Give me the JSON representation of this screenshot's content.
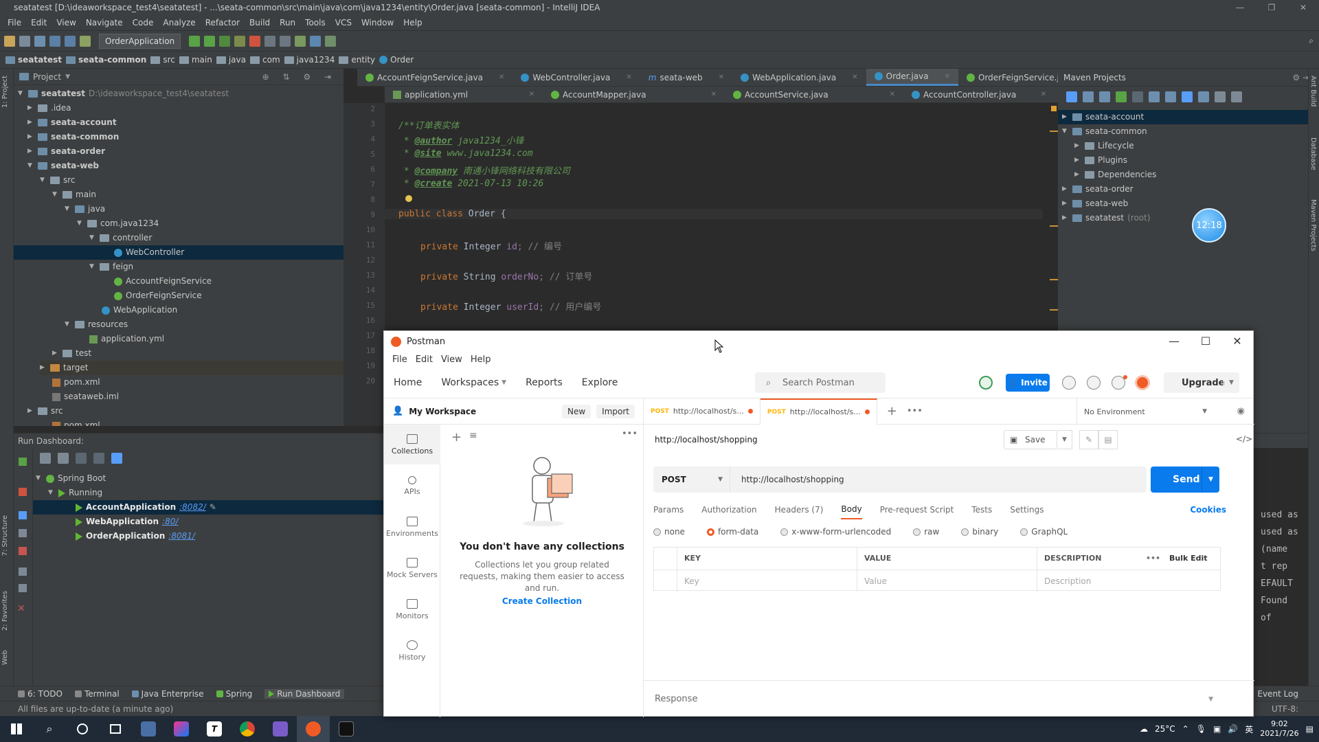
{
  "ide": {
    "title": "seatatest [D:\\ideaworkspace_test4\\seatatest] - ...\\seata-common\\src\\main\\java\\com\\java1234\\entity\\Order.java [seata-common] - IntelliJ IDEA",
    "menu": [
      "File",
      "Edit",
      "View",
      "Navigate",
      "Code",
      "Analyze",
      "Refactor",
      "Build",
      "Run",
      "Tools",
      "VCS",
      "Window",
      "Help"
    ],
    "run_config": "OrderApplication",
    "breadcrumb": [
      "seatatest",
      "seata-common",
      "src",
      "main",
      "java",
      "com",
      "java1234",
      "entity",
      "Order"
    ],
    "project": {
      "header": "Project",
      "root": "seatatest",
      "root_path": "D:\\ideaworkspace_test4\\seatatest",
      "items": [
        ".idea",
        "seata-account",
        "seata-common",
        "seata-order",
        "seata-web",
        "src",
        "main",
        "java",
        "com.java1234",
        "controller",
        "WebController",
        "feign",
        "AccountFeignService",
        "OrderFeignService",
        "WebApplication",
        "resources",
        "application.yml",
        "test",
        "target",
        "pom.xml",
        "seataweb.iml",
        "src",
        "pom.xml"
      ]
    },
    "tabs_row1": [
      {
        "label": "AccountFeignService.java",
        "active": false
      },
      {
        "label": "WebController.java",
        "active": false
      },
      {
        "label": "seata-web",
        "active": false
      },
      {
        "label": "WebApplication.java",
        "active": false
      },
      {
        "label": "Order.java",
        "active": true
      },
      {
        "label": "OrderFeignService.java",
        "active": false
      }
    ],
    "tabs_row2": [
      "application.yml",
      "AccountMapper.java",
      "AccountService.java",
      "AccountController.java"
    ],
    "code": {
      "line_numbers": [
        "2",
        "3",
        "4",
        "5",
        "6",
        "7",
        "8",
        "9",
        "10",
        "11",
        "12",
        "13",
        "14",
        "15",
        "16",
        "17",
        "18",
        "19",
        "20"
      ],
      "doc_open": "/**订单表实体",
      "author_tag": "@author",
      "author_val": " java1234_小锋",
      "site_tag": "@site",
      "site_val": " www.java1234.com",
      "company_tag": "@company",
      "company_val": " 南通小锋网络科技有限公司",
      "create_tag": "@create",
      "create_val": " 2021-07-13 10:26",
      "class_kw": "public class ",
      "class_name": "Order {",
      "f1_kw": "private ",
      "f1_type": "Integer ",
      "f1_name": "id",
      "f1_cmt": "; // 编号",
      "f2_kw": "private ",
      "f2_type": "String ",
      "f2_name": "orderNo",
      "f2_cmt": "; // 订单号",
      "f3_kw": "private ",
      "f3_type": "Integer ",
      "f3_name": "userId",
      "f3_cmt": "; // 用户编号"
    },
    "maven": {
      "header": "Maven Projects",
      "items": [
        "seata-account",
        "seata-common",
        "Lifecycle",
        "Plugins",
        "Dependencies",
        "seata-order",
        "seata-web",
        "seatatest"
      ],
      "root_suffix": "(root)"
    },
    "timer": "12:18",
    "run_dashboard": {
      "header": "Run Dashboard:",
      "group": "Spring Boot",
      "state": "Running",
      "apps": [
        {
          "name": "AccountApplication",
          "port": ":8082/"
        },
        {
          "name": "WebApplication",
          "port": ":80/"
        },
        {
          "name": "OrderApplication",
          "port": ":8081/"
        }
      ]
    },
    "console": [
      "used as",
      "used as",
      "(name",
      "t rep",
      "EFAULT",
      "Found",
      "of"
    ],
    "bottom_tabs": [
      "6: TODO",
      "Terminal",
      "Java Enterprise",
      "Spring",
      "Run Dashboard",
      "Event Log"
    ],
    "status": "All files are up-to-date (a minute ago)",
    "encoding": "UTF-8:",
    "side_labels": {
      "project": "1: Project",
      "structure": "7: Structure",
      "favorites": "2: Favorites",
      "web": "Web",
      "ant": "Ant Build",
      "database": "Database",
      "maven": "Maven Projects"
    }
  },
  "postman": {
    "title": "Postman",
    "menu": [
      "File",
      "Edit",
      "View",
      "Help"
    ],
    "nav": [
      "Home",
      "Workspaces",
      "Reports",
      "Explore"
    ],
    "search_placeholder": "Search Postman",
    "invite": "Invite",
    "upgrade": "Upgrade",
    "workspace": "My Workspace",
    "new_label": "New",
    "import_label": "Import",
    "sidebar": [
      "Collections",
      "APIs",
      "Environments",
      "Mock Servers",
      "Monitors",
      "History"
    ],
    "empty_title": "You don't have any collections",
    "empty_desc": "Collections let you group related requests, making them easier to access and run.",
    "create_collection": "Create Collection",
    "request_tabs": [
      {
        "method": "POST",
        "url": "http://localhost/s...",
        "active": false
      },
      {
        "method": "POST",
        "url": "http://localhost/s...",
        "active": true
      }
    ],
    "environment": "No Environment",
    "request_name": "http://localhost/shopping",
    "save": "Save",
    "method": "POST",
    "url": "http://localhost/shopping",
    "send": "Send",
    "option_tabs": [
      "Params",
      "Authorization",
      "Headers (7)",
      "Body",
      "Pre-request Script",
      "Tests",
      "Settings"
    ],
    "active_option": "Body",
    "cookies": "Cookies",
    "body_types": [
      "none",
      "form-data",
      "x-www-form-urlencoded",
      "raw",
      "binary",
      "GraphQL"
    ],
    "selected_body_type": "form-data",
    "table_headers": [
      "KEY",
      "VALUE",
      "DESCRIPTION"
    ],
    "bulk_edit": "Bulk Edit",
    "table_placeholders": [
      "Key",
      "Value",
      "Description"
    ],
    "response": "Response"
  },
  "taskbar": {
    "temperature": "25°C",
    "ime": "英",
    "time": "9:02",
    "date": "2021/7/26"
  },
  "colors": {
    "postman_orange": "#ef5b25",
    "postman_blue": "#097bed",
    "ide_bg": "#2b2b2b",
    "ide_panel": "#3c3f41"
  }
}
